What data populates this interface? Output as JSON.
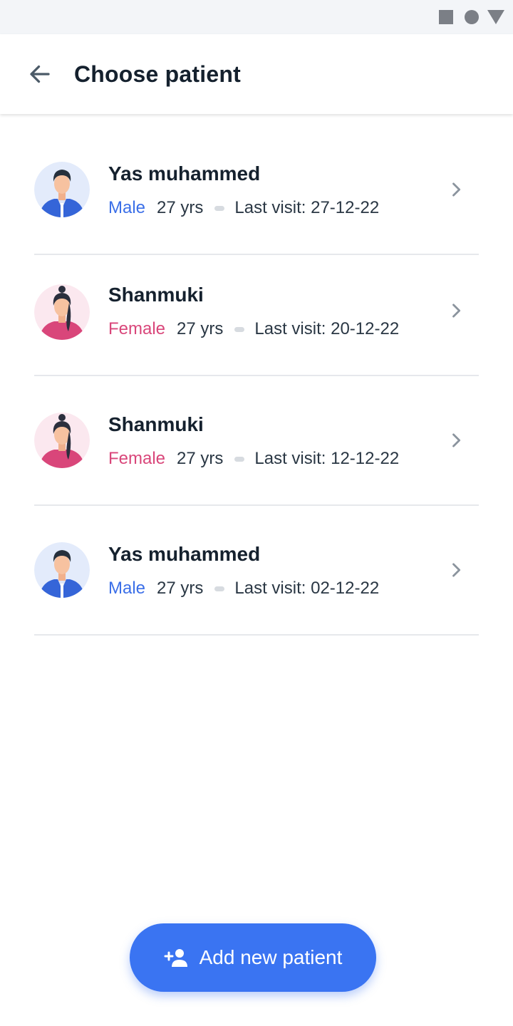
{
  "status_bar": {
    "icons": [
      "square-icon",
      "circle-icon",
      "triangle-icon"
    ],
    "icon_color": "#7b7f86"
  },
  "header": {
    "title": "Choose patient",
    "back_icon": "arrow-left-icon"
  },
  "patients": [
    {
      "name": "Yas muhammed",
      "gender": "Male",
      "age": "27 yrs",
      "last_visit": "Last visit: 27-12-22",
      "avatar": "male-avatar"
    },
    {
      "name": "Shanmuki",
      "gender": "Female",
      "age": "27 yrs",
      "last_visit": "Last visit: 20-12-22",
      "avatar": "female-avatar"
    },
    {
      "name": "Shanmuki",
      "gender": "Female",
      "age": "27 yrs",
      "last_visit": "Last visit: 12-12-22",
      "avatar": "female-avatar"
    },
    {
      "name": "Yas muhammed",
      "gender": "Male",
      "age": "27 yrs",
      "last_visit": "Last visit: 02-12-22",
      "avatar": "male-avatar"
    }
  ],
  "fab": {
    "label": "Add new patient",
    "icon": "add-person-icon"
  },
  "colors": {
    "accent": "#3a74f2",
    "male": "#3b6fe8",
    "female": "#d9467a",
    "divider": "#e6e8ec"
  }
}
